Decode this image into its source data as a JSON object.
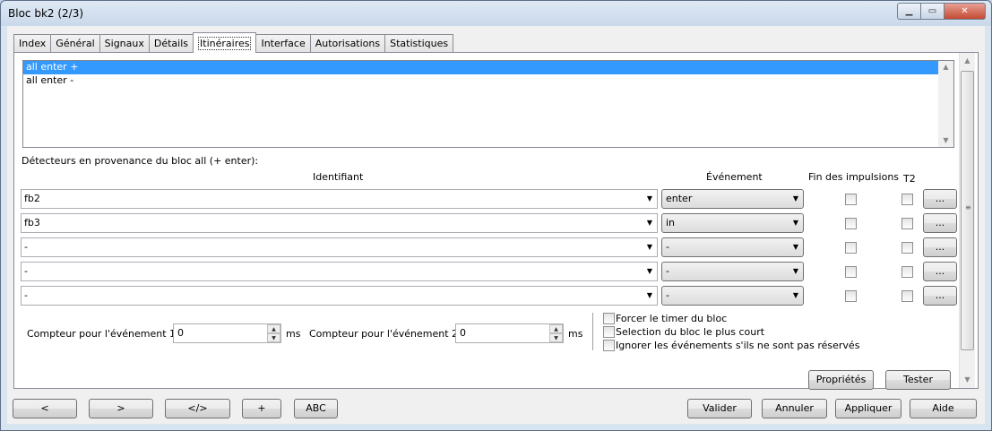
{
  "window": {
    "title": "Bloc bk2 (2/3)"
  },
  "tabs": [
    "Index",
    "Général",
    "Signaux",
    "Détails",
    "Itinéraires",
    "Interface",
    "Autorisations",
    "Statistiques"
  ],
  "list": {
    "items": [
      "all enter +",
      "all enter -"
    ]
  },
  "detectors": {
    "caption": "Détecteurs en provenance du bloc all (+ enter):",
    "col_identifiant": "Identifiant",
    "col_event": "Événement",
    "col_fin": "Fin des impulsions",
    "col_t2": "T2",
    "rows": [
      {
        "id": "fb2",
        "event": "enter"
      },
      {
        "id": "fb3",
        "event": "in"
      },
      {
        "id": "-",
        "event": "-"
      },
      {
        "id": "-",
        "event": "-"
      },
      {
        "id": "-",
        "event": "-"
      }
    ],
    "dots_label": "..."
  },
  "counters": {
    "c1_label": "Compteur pour l'événement 1",
    "c1_value": "0",
    "c2_label": "Compteur pour l'événement 2",
    "c2_value": "0",
    "unit": "ms"
  },
  "options": [
    "Forcer le timer du bloc",
    "Selection du bloc le plus court",
    "Ignorer les événements s'ils ne sont pas réservés"
  ],
  "panel_buttons": {
    "props": "Propriétés",
    "test": "Tester"
  },
  "footer": {
    "prev": "<",
    "next": ">",
    "code": "</>",
    "plus": "+",
    "abc": "ABC",
    "valider": "Valider",
    "annuler": "Annuler",
    "appliquer": "Appliquer",
    "aide": "Aide"
  }
}
